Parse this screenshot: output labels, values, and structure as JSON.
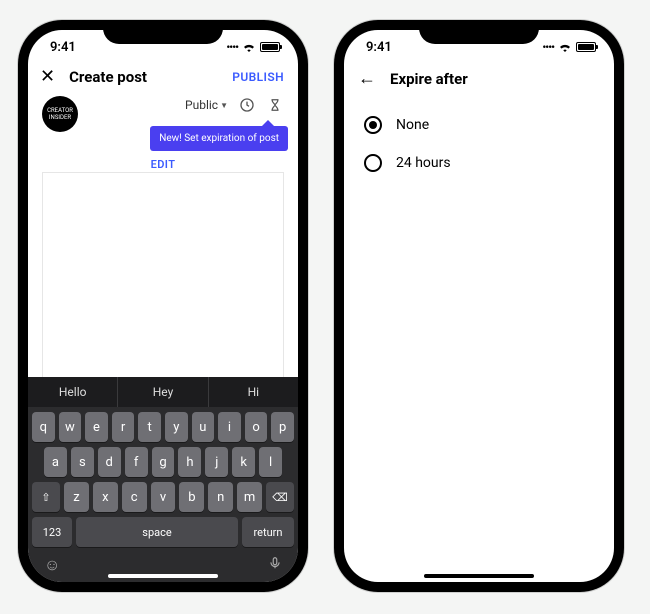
{
  "status": {
    "time": "9:41",
    "signal": "••••",
    "wifi": "wifi",
    "battery": "full"
  },
  "left": {
    "header": {
      "title": "Create post",
      "publish": "PUBLISH"
    },
    "avatarText": "CREATOR INSIDER",
    "visibility": "Public",
    "tooltip": "New! Set expiration of post",
    "edit": "EDIT",
    "suggestions": [
      "Hello",
      "Hey",
      "Hi"
    ],
    "rows": {
      "r1": [
        "q",
        "w",
        "e",
        "r",
        "t",
        "y",
        "u",
        "i",
        "o",
        "p"
      ],
      "r2": [
        "a",
        "s",
        "d",
        "f",
        "g",
        "h",
        "j",
        "k",
        "l"
      ],
      "r3": [
        "⇧",
        "z",
        "x",
        "c",
        "v",
        "b",
        "n",
        "m",
        "⌫"
      ]
    },
    "bottom": {
      "num": "123",
      "space": "space",
      "ret": "return"
    }
  },
  "right": {
    "title": "Expire after",
    "options": [
      {
        "label": "None",
        "selected": true
      },
      {
        "label": "24 hours",
        "selected": false
      }
    ]
  }
}
